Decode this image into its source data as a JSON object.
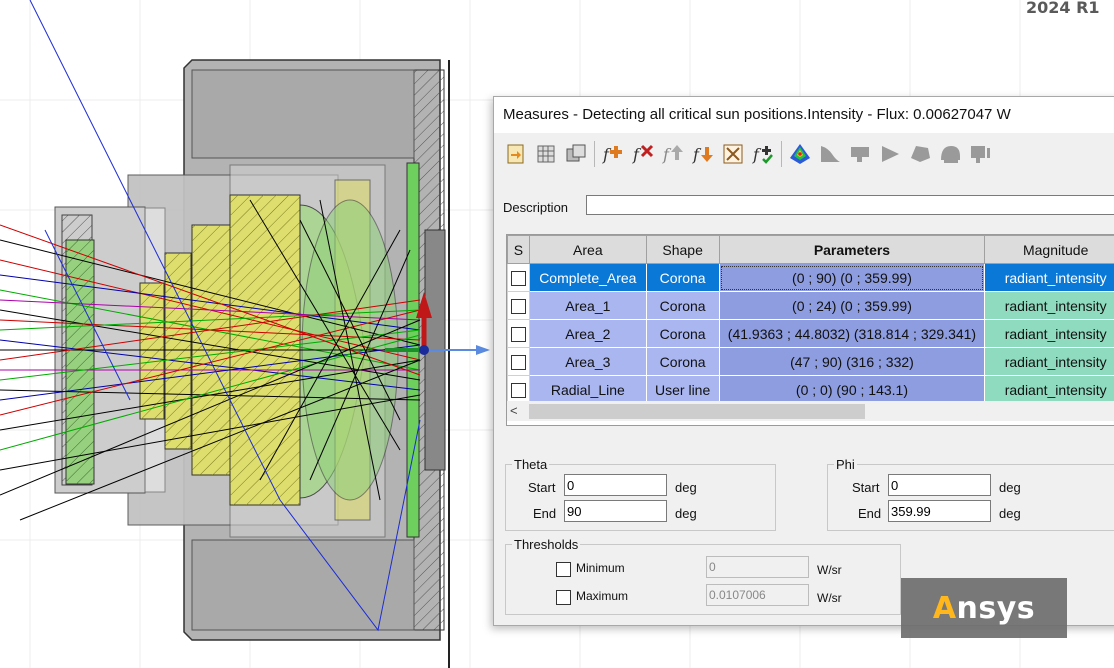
{
  "version_label": "2024 R1",
  "dialog": {
    "title": "Measures - Detecting all critical sun positions.Intensity - Flux: 0.00627047 W",
    "toolbar_icons": [
      "import-icon",
      "grid-icon",
      "copy-icon",
      "add-measure-icon",
      "delete-measure-icon",
      "move-up-icon",
      "move-down-icon",
      "clear-icon",
      "validate-icon",
      "color-map-icon",
      "shape-icon-1",
      "shape-icon-2",
      "shape-icon-3",
      "shape-icon-4",
      "shape-icon-5",
      "shape-icon-6"
    ],
    "description": {
      "label": "Description",
      "value": ""
    },
    "table": {
      "headers": {
        "s": "S",
        "area": "Area",
        "shape": "Shape",
        "parameters": "Parameters",
        "magnitude": "Magnitude"
      },
      "rows": [
        {
          "area": "Complete_Area",
          "shape": "Corona",
          "parameters": "(0 ; 90) (0 ; 359.99)",
          "magnitude": "radiant_intensity",
          "selected": true
        },
        {
          "area": "Area_1",
          "shape": "Corona",
          "parameters": "(0 ; 24) (0 ; 359.99)",
          "magnitude": "radiant_intensity",
          "selected": false
        },
        {
          "area": "Area_2",
          "shape": "Corona",
          "parameters": "(41.9363 ; 44.8032) (318.814 ; 329.341)",
          "magnitude": "radiant_intensity",
          "selected": false
        },
        {
          "area": "Area_3",
          "shape": "Corona",
          "parameters": "(47 ; 90) (316 ; 332)",
          "magnitude": "radiant_intensity",
          "selected": false
        },
        {
          "area": "Radial_Line",
          "shape": "User line",
          "parameters": "(0 ; 0) (90 ; 143.1)",
          "magnitude": "radiant_intensity",
          "selected": false
        }
      ]
    },
    "theta": {
      "legend": "Theta",
      "start_label": "Start",
      "start": "0",
      "end_label": "End",
      "end": "90",
      "unit": "deg"
    },
    "phi": {
      "legend": "Phi",
      "start_label": "Start",
      "start": "0",
      "end_label": "End",
      "end": "359.99",
      "unit": "deg"
    },
    "thresholds": {
      "legend": "Thresholds",
      "min_label": "Minimum",
      "min_value": "0",
      "max_label": "Maximum",
      "max_value": "0.0107006",
      "unit": "W/sr"
    }
  },
  "logo": {
    "accent": "A",
    "rest": "nsys"
  },
  "colors": {
    "selection": "#0a78d7",
    "param_cell": "#8d9de0",
    "area_cell": "#aab6f0",
    "magnitude_cell": "#8fdbc0"
  }
}
